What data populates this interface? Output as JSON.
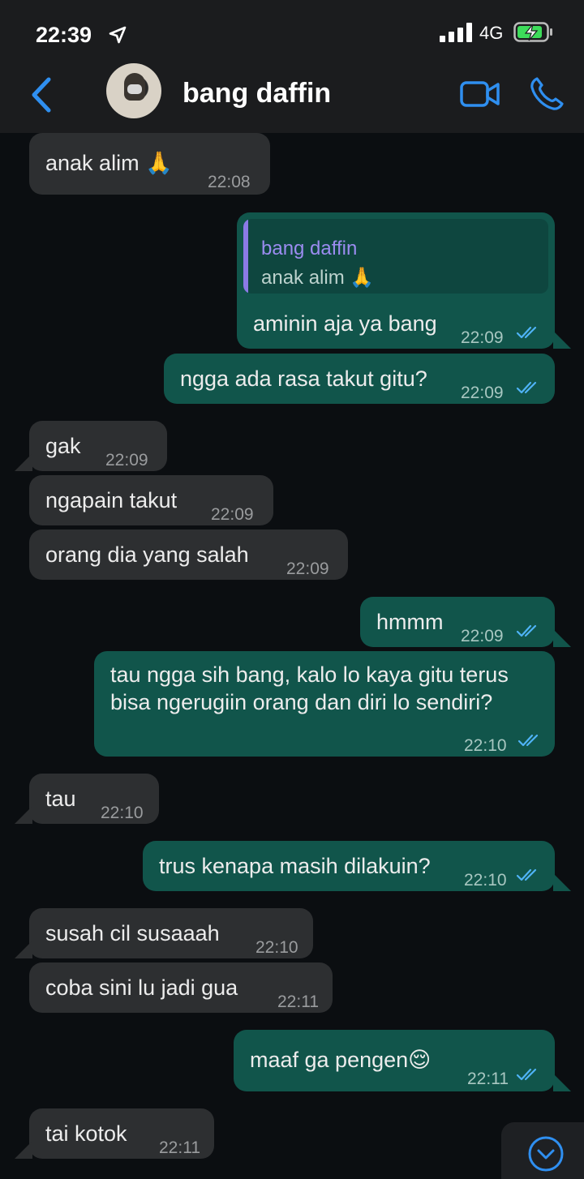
{
  "status": {
    "time": "22:39",
    "network": "4G"
  },
  "header": {
    "contact_name": "bang daffin"
  },
  "messages": [
    {
      "text": "anak alim 🙏",
      "time": "22:08"
    },
    {
      "quote_name": "bang daffin",
      "quote_text": "anak alim 🙏",
      "text": "aminin aja ya bang",
      "time": "22:09"
    },
    {
      "text": "ngga ada rasa takut gitu?",
      "time": "22:09"
    },
    {
      "text": "gak",
      "time": "22:09"
    },
    {
      "text": "ngapain takut",
      "time": "22:09"
    },
    {
      "text": "orang dia yang salah",
      "time": "22:09"
    },
    {
      "text": "hmmm",
      "time": "22:09"
    },
    {
      "text": "tau ngga sih bang, kalo lo kaya gitu terus bisa ngerugiin orang dan diri lo sendiri?",
      "time": "22:10"
    },
    {
      "text": "tau",
      "time": "22:10"
    },
    {
      "text": "trus kenapa masih dilakuin?",
      "time": "22:10"
    },
    {
      "text": "susah cil susaaah",
      "time": "22:10"
    },
    {
      "text": "coba sini lu jadi gua",
      "time": "22:11"
    },
    {
      "text": "maaf ga pengen😌",
      "time": "22:11"
    },
    {
      "text": "tai kotok",
      "time": "22:11"
    }
  ],
  "colors": {
    "accent": "#2f8ff0",
    "outgoing_bubble": "#11554b",
    "incoming_bubble": "#2d2f31",
    "read_ticks": "#4fb3f6"
  }
}
